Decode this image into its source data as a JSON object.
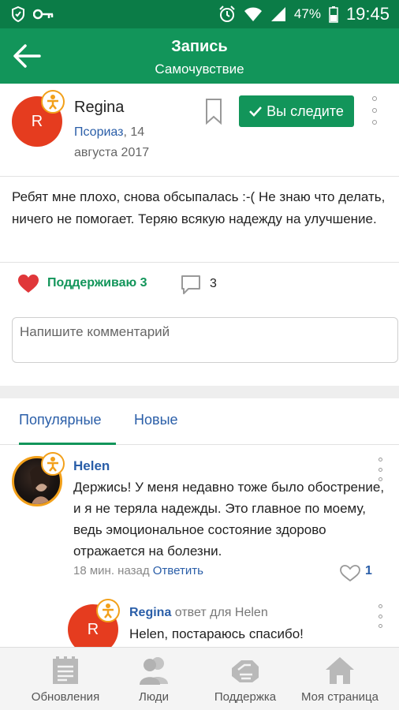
{
  "status_bar": {
    "battery": "47%",
    "time": "19:45"
  },
  "app_bar": {
    "title": "Запись",
    "subtitle": "Самочувствие"
  },
  "post": {
    "avatar_letter": "R",
    "author": "Regina",
    "tag": "Псориаз",
    "date_part1": ", 14",
    "date_part2": "августа 2017",
    "follow_label": "Вы следите",
    "body": "Ребят мне плохо, снова обсыпалась :-( Не знаю что делать, ничего не помогает. Теряю всякую надежду на улучшение.",
    "support_label": "Поддерживаю 3",
    "comment_count": "3"
  },
  "comment_input": {
    "placeholder": "Напишите комментарий"
  },
  "tabs": {
    "popular": "Популярные",
    "new": "Новые"
  },
  "comments": [
    {
      "author": "Helen",
      "text": "Держись! У меня недавно тоже было обострение, и я не теряла надежды. Это главное по моему, ведь эмоциональное состояние здорово отражается на болезни.",
      "time": "18 мин. назад",
      "reply_label": "Ответить",
      "likes": "1"
    },
    {
      "avatar_letter": "R",
      "author": "Regina",
      "reply_to": " ответ для Helen",
      "text": "Helen, постараюсь спасибо!"
    }
  ],
  "bottom_nav": [
    {
      "label": "Обновления",
      "icon": "updates-icon"
    },
    {
      "label": "Люди",
      "icon": "people-icon"
    },
    {
      "label": "Поддержка",
      "icon": "support-icon"
    },
    {
      "label": "Моя страница",
      "icon": "home-icon"
    }
  ],
  "colors": {
    "primary": "#12955a",
    "status_bar": "#0b7c47",
    "link": "#2a5ea8",
    "avatar": "#e53c1f",
    "badge": "#f2a01a",
    "heart": "#e0373a"
  }
}
